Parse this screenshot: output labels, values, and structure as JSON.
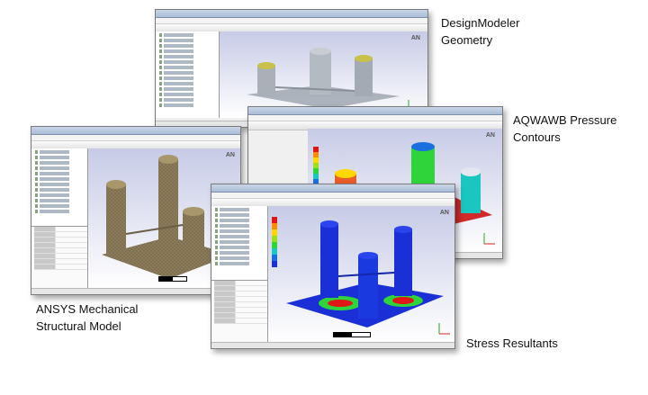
{
  "captions": {
    "design_modeler": "DesignModeler\nGeometry",
    "aqwa_pressure": "AQWAWB Pressure\nContours",
    "mechanical": "ANSYS Mechanical\nStructural Model",
    "stress": "Stress Resultants"
  },
  "colors": {
    "viewport_top": "#c7cbe6",
    "geometry_gray": "#9fa7b0",
    "geometry_yellow": "#c8c24a",
    "mesh_tan": "#8b7b5a",
    "stress_blue": "#1b2fd6",
    "stress_red": "#e01515",
    "stress_green": "#2fd43a"
  },
  "icons": [
    "ansys-logo-icon",
    "axis-triad-icon",
    "tree-folder-icon",
    "contour-legend-icon"
  ]
}
